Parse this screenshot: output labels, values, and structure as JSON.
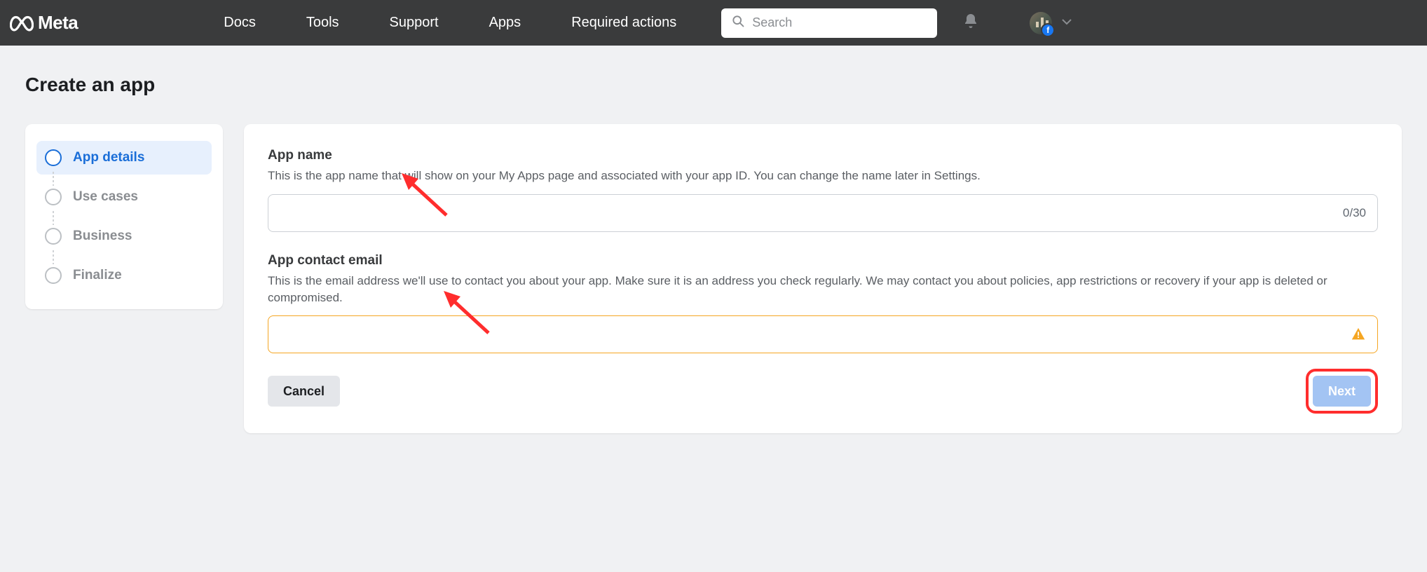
{
  "brand": {
    "name": "Meta"
  },
  "nav": {
    "items": [
      {
        "label": "Docs"
      },
      {
        "label": "Tools"
      },
      {
        "label": "Support"
      },
      {
        "label": "Apps"
      },
      {
        "label": "Required actions"
      }
    ]
  },
  "search": {
    "placeholder": "Search"
  },
  "page": {
    "title": "Create an app"
  },
  "steps": {
    "items": [
      {
        "label": "App details",
        "active": true
      },
      {
        "label": "Use cases",
        "active": false
      },
      {
        "label": "Business",
        "active": false
      },
      {
        "label": "Finalize",
        "active": false
      }
    ]
  },
  "form": {
    "app_name": {
      "label": "App name",
      "desc": "This is the app name that will show on your My Apps page and associated with your app ID. You can change the name later in Settings.",
      "value": "",
      "counter": "0/30"
    },
    "contact_email": {
      "label": "App contact email",
      "desc": "This is the email address we'll use to contact you about your app. Make sure it is an address you check regularly. We may contact you about policies, app restrictions or recovery if your app is deleted or compromised.",
      "value": ""
    },
    "cancel_label": "Cancel",
    "next_label": "Next"
  }
}
